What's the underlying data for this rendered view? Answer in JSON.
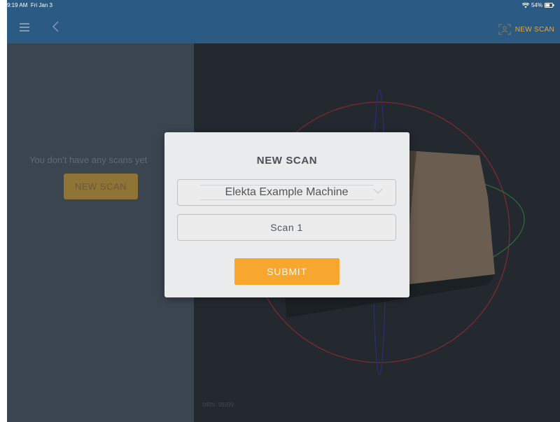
{
  "status_bar": {
    "time": "9:19 AM",
    "date": "Fri Jan 3",
    "battery": "54%"
  },
  "nav": {
    "new_scan_label": "NEW SCAN",
    "menu_icon": "hamburger-icon",
    "back_icon": "chevron-left-icon",
    "scan_icon": "scan-viewfinder-icon"
  },
  "left_panel": {
    "empty_message": "You don't have any scans yet",
    "new_scan_button": "NEW SCAN"
  },
  "viewer": {
    "mrn": "MRN: 99999"
  },
  "modal": {
    "title": "NEW SCAN",
    "machine_select_value": "Elekta Example Machine",
    "scan_name_value": "Scan 1",
    "submit_label": "SUBMIT"
  },
  "colors": {
    "navbar": "#2b5a82",
    "accent": "#f8a72e",
    "left_panel": "#3b4550",
    "viewer_bg": "#23292f"
  }
}
